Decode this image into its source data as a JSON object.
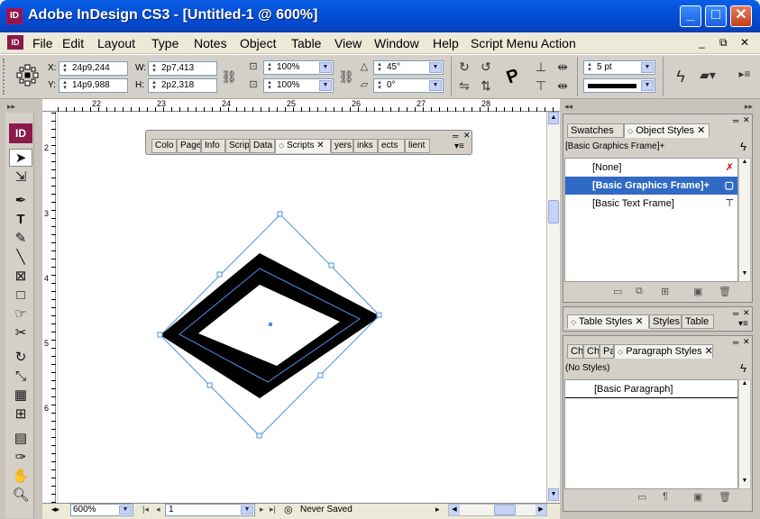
{
  "window": {
    "title": "Adobe InDesign CS3 - [Untitled-1 @ 600%]",
    "app_icon": "ID",
    "minimize": "_",
    "maximize": "□",
    "close": "✕"
  },
  "menu": [
    "File",
    "Edit",
    "Layout",
    "Type",
    "Notes",
    "Object",
    "Table",
    "View",
    "Window",
    "Help",
    "Script Menu Action"
  ],
  "doc_controls": {
    "minimize": "_",
    "restore": "⧉",
    "close": "✕"
  },
  "control_bar": {
    "x_label": "X:",
    "x_value": "24p9,244",
    "y_label": "Y:",
    "y_value": "14p9,988",
    "w_label": "W:",
    "w_value": "2p7,413",
    "h_label": "H:",
    "h_value": "2p2,318",
    "scale_x": "100%",
    "scale_y": "100%",
    "rotation": "45°",
    "shear": "0°",
    "stroke_weight": "5 pt"
  },
  "rulers": {
    "top": [
      "22",
      "23",
      "24",
      "25",
      "26",
      "27",
      "28"
    ],
    "left": [
      "2",
      "3",
      "4",
      "5",
      "6"
    ]
  },
  "float_panel": {
    "tabs": [
      "Colo",
      "Page",
      "Info",
      "Scrip",
      "Data",
      "Scripts",
      "yers",
      "inks",
      "ects",
      "lient"
    ],
    "active_tab": "Scripts",
    "close_glyph": "✕"
  },
  "object_styles_panel": {
    "tabs": [
      "Swatches",
      "Object Styles"
    ],
    "current": "[Basic Graphics Frame]+",
    "items": [
      "[None]",
      "[Basic Graphics Frame]+",
      "[Basic Text Frame]"
    ],
    "selected_index": 1
  },
  "table_styles_panel": {
    "tabs": [
      "Table Styles",
      "Styles",
      "Table"
    ]
  },
  "paragraph_styles_panel": {
    "tabs": [
      "Ch",
      "Ch",
      "Pa",
      "Paragraph Styles"
    ],
    "current": "(No Styles)",
    "items": [
      "[Basic Paragraph]"
    ]
  },
  "status": {
    "zoom": "600%",
    "page": "1",
    "save_state": "Never Saved"
  },
  "colors": {
    "title_bar": "#0550d8",
    "selection": "#316ac5",
    "frame_stroke": "#000000",
    "bounding_box": "#4a90e2"
  }
}
